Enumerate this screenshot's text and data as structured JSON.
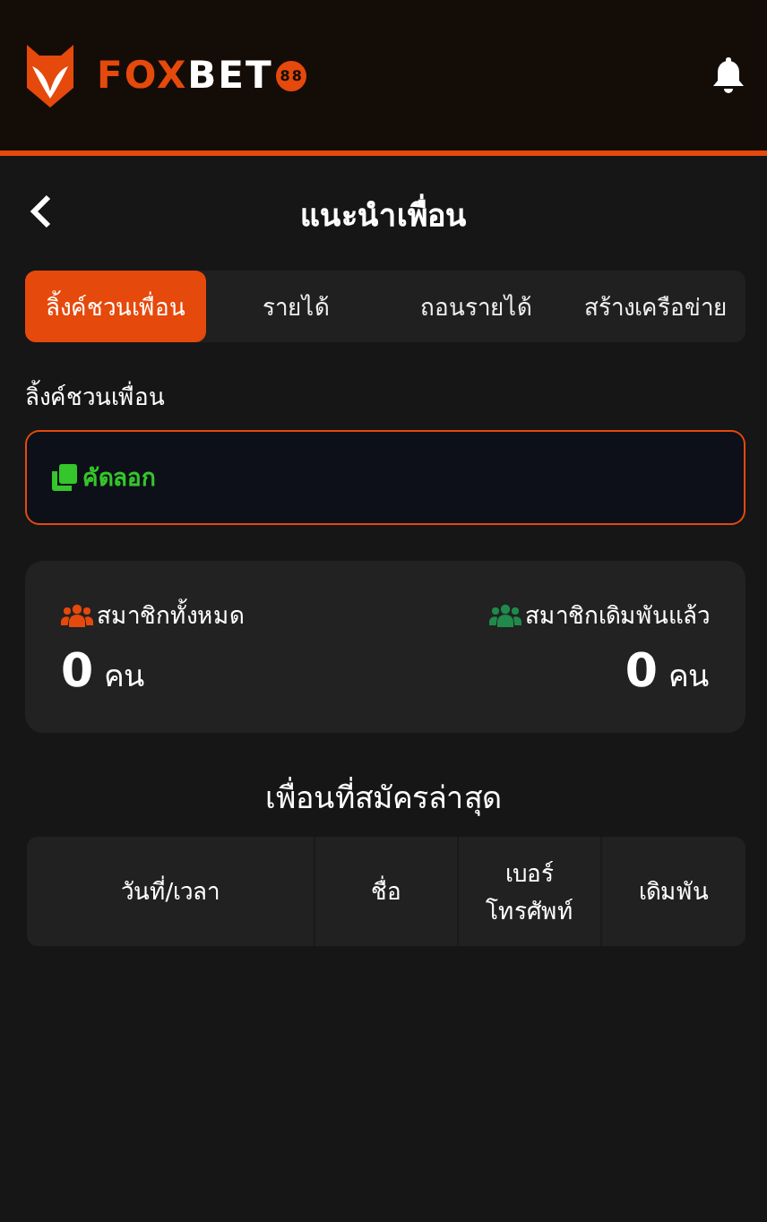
{
  "header": {
    "logo": {
      "part_1": "FOX",
      "part_2": "BET",
      "badge": "88"
    }
  },
  "nav": {
    "title": "แนะนำเพื่อน"
  },
  "tabs": [
    {
      "label": "ลิ้งค์ชวนเพื่อน",
      "selected": true
    },
    {
      "label": "รายได้",
      "selected": false
    },
    {
      "label": "ถอนรายได้",
      "selected": false
    },
    {
      "label": "สร้างเครือข่าย",
      "selected": false
    }
  ],
  "link_section": {
    "label": "ลิ้งค์ชวนเพื่อน",
    "copy_button": "คัดลอก"
  },
  "stats": [
    {
      "label": "สมาชิกทั้งหมด",
      "value": "0",
      "unit": "คน",
      "color": "#e5490c"
    },
    {
      "label": "สมาชิกเดิมพันแล้ว",
      "value": "0",
      "unit": "คน",
      "color": "#1f8a4c"
    }
  ],
  "recent": {
    "title": "เพื่อนที่สมัครล่าสุด",
    "columns": [
      "วันที่/เวลา",
      "ชื่อ",
      "เบอร์ โทรศัพท์",
      "เดิมพัน"
    ]
  }
}
